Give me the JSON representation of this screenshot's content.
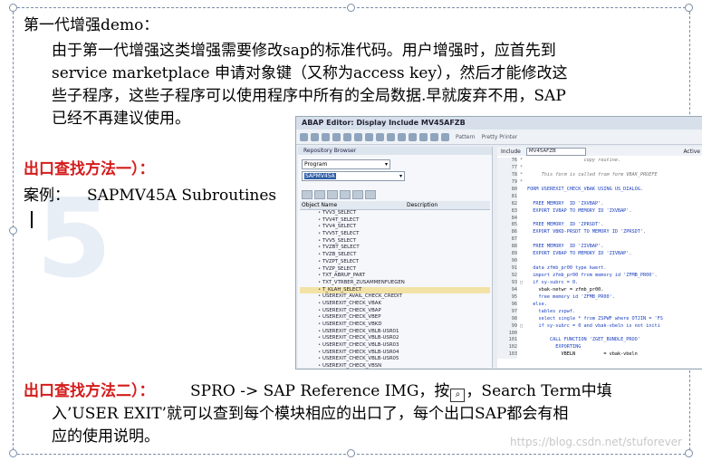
{
  "heading": "第一代增强demo：",
  "paragraph_lines": [
    "由于第一代增强这类增强需要修改sap的标准代码。用户增强时，应首先到",
    "service marketplace 申请对象键（又称为access key），然后才能修改这",
    "些子程序，这些子程序可以使用程序中所有的全局数据.早就废弃不用，SAP",
    "已经不再建议使用。"
  ],
  "method1_title": "出口查找方法一）：",
  "example_label": "案例：",
  "example_value": "SAPMV45A Subroutines",
  "method2_title": "出口查找方法二）：",
  "method2_line1_a": "SPRO -> SAP Reference IMG，按",
  "method2_line1_b": "，Search Term中填",
  "method2_line2": "入’USER EXIT’就可以查到每个模块相应的出口了，每个出口SAP都会有相",
  "method2_line3": "应的使用说明。",
  "credit": "https://blog.csdn.net/stuforever",
  "sap": {
    "title": "ABAP Editor: Display Include MV45AFZB",
    "toolbar_labels": [
      "Pattern",
      "Pretty Printer"
    ],
    "repo_browser": "Repository Browser",
    "program_select": "Program",
    "program_input": "SAPMV45A",
    "col_object": "Object Name",
    "col_desc": "Description",
    "tree_items": [
      "TVV3_SELECT",
      "TVV4T_SELECT",
      "TVV4_SELECT",
      "TVV5T_SELECT",
      "TVV5_SELECT",
      "TVZBT_SELECT",
      "TVZB_SELECT",
      "TVZPT_SELECT",
      "TVZP_SELECT",
      "TXT_ABRUF_PART",
      "TXT_VTRBER_ZUSAMMENFUEGEN",
      "T_KLAH_SELECT",
      "USEREXIT_AVAIL_CHECK_CREDIT",
      "USEREXIT_CHECK_VBAK",
      "USEREXIT_CHECK_VBAP",
      "USEREXIT_CHECK_VBEP",
      "USEREXIT_CHECK_VBKD",
      "USEREXIT_CHECK_VBLB-USR01",
      "USEREXIT_CHECK_VBLB-USR02",
      "USEREXIT_CHECK_VBLB-USR03",
      "USEREXIT_CHECK_VBLB-USR04",
      "USEREXIT_CHECK_VBLB-USR05",
      "USEREXIT_CHECK_VBSN"
    ],
    "selected_item": "T_KLAH_SELECT",
    "include_label": "Include",
    "include_value": "MV45AFZB",
    "active_label": "Active",
    "code_lines": [
      {
        "ln": "76",
        "gut": "*",
        "code": "                    copy routine.",
        "cls": "c"
      },
      {
        "ln": "77",
        "gut": "*",
        "code": "",
        "cls": "c"
      },
      {
        "ln": "78",
        "gut": "*",
        "code": "     This form is called from form VBAK_PRUEFE",
        "cls": "c"
      },
      {
        "ln": "79",
        "gut": "*",
        "code": "",
        "cls": "c"
      },
      {
        "ln": "80",
        "gut": "",
        "code": "FORM USEREXIT_CHECK_VBAK USING US_DIALOG.",
        "cls": "k"
      },
      {
        "ln": "81",
        "gut": "",
        "code": "",
        "cls": "p"
      },
      {
        "ln": "82",
        "gut": "",
        "code": "  FREE MEMORY  ID 'ZXVBAP'.",
        "cls": "k"
      },
      {
        "ln": "83",
        "gut": "",
        "code": "  EXPORT IVBAP TO MEMORY ID 'ZXVBAP'.",
        "cls": "k"
      },
      {
        "ln": "84",
        "gut": "",
        "code": "",
        "cls": "p"
      },
      {
        "ln": "85",
        "gut": "",
        "code": "  FREE MEMORY  ID 'ZPRSDT'.",
        "cls": "k"
      },
      {
        "ln": "86",
        "gut": "",
        "code": "  EXPORT VBKD-PRSDT TO MEMORY ID 'ZPRSDT'.",
        "cls": "k"
      },
      {
        "ln": "87",
        "gut": "",
        "code": "",
        "cls": "p"
      },
      {
        "ln": "88",
        "gut": "",
        "code": "  FREE MEMORY  ID 'ZIVBAP'.",
        "cls": "k"
      },
      {
        "ln": "89",
        "gut": "",
        "code": "  EXPORT IVBAP TO MEMORY ID 'ZIVBAP'.",
        "cls": "k"
      },
      {
        "ln": "90",
        "gut": "",
        "code": "",
        "cls": "p"
      },
      {
        "ln": "91",
        "gut": "",
        "code": "  data zfmb_pr00 type kwert.",
        "cls": "k"
      },
      {
        "ln": "92",
        "gut": "",
        "code": "  import zfmb_pr00 from memory id 'ZFMB_PR00'.",
        "cls": "k"
      },
      {
        "ln": "93",
        "gut": "□",
        "code": "  if sy-subrc = 0.",
        "cls": "k"
      },
      {
        "ln": "94",
        "gut": "",
        "code": "    vbak-netwr = zfmb_pr00.",
        "cls": "p"
      },
      {
        "ln": "95",
        "gut": "",
        "code": "    free memory id 'ZFMB_PR00'.",
        "cls": "k"
      },
      {
        "ln": "96",
        "gut": "",
        "code": "  else.",
        "cls": "k"
      },
      {
        "ln": "97",
        "gut": "",
        "code": "    tables zspwf.",
        "cls": "k"
      },
      {
        "ln": "98",
        "gut": "",
        "code": "    select single * from ZSPWF where OTJIN = 'FS",
        "cls": "k"
      },
      {
        "ln": "99",
        "gut": "□",
        "code": "    if sy-subrc = 0 and vbak-vbeln is not initi",
        "cls": "k"
      },
      {
        "ln": "100",
        "gut": "",
        "code": "",
        "cls": "p"
      },
      {
        "ln": "101",
        "gut": "",
        "code": "        CALL FUNCTION 'ZGET_BUNDLE_PROO'",
        "cls": "k"
      },
      {
        "ln": "102",
        "gut": "",
        "code": "          EXPORTING",
        "cls": "k"
      },
      {
        "ln": "103",
        "gut": "",
        "code": "            VBELN          = vbak-vbeln",
        "cls": "p"
      }
    ]
  }
}
